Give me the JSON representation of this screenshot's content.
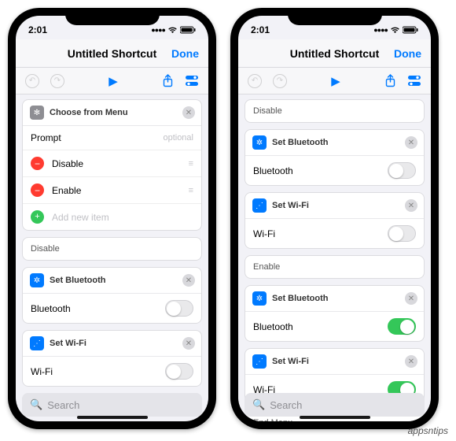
{
  "status": {
    "time": "2:01"
  },
  "nav": {
    "title": "Untitled Shortcut",
    "done": "Done"
  },
  "menu_card": {
    "title": "Choose from Menu",
    "prompt_label": "Prompt",
    "prompt_placeholder": "optional",
    "items": [
      "Disable",
      "Enable"
    ],
    "add_label": "Add new item"
  },
  "sections": {
    "disable": "Disable",
    "enable": "Enable",
    "end_menu": "End Menu"
  },
  "bluetooth_card": {
    "title": "Set Bluetooth",
    "field": "Bluetooth"
  },
  "wifi_card": {
    "title": "Set Wi-Fi",
    "field": "Wi-Fi"
  },
  "search": {
    "placeholder": "Search"
  },
  "watermark": "appsntips"
}
